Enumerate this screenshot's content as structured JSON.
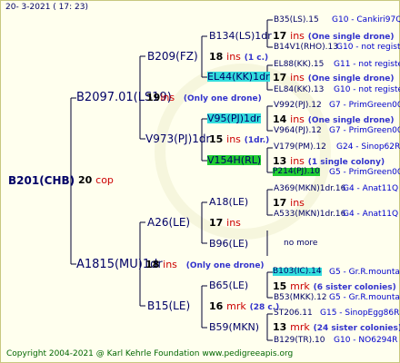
{
  "header": {
    "date": "20-  3-2021  ( 17: 23)"
  },
  "root": {
    "name": "B201(CHB)",
    "count": "20",
    "unit": "cop"
  },
  "gen1": [
    {
      "name": "B2097.01(LS19)",
      "count": "19",
      "unit": "ins",
      "note": "(Only one drone)"
    },
    {
      "name": "A1815(MU)1dr",
      "count": "18",
      "unit": "ins",
      "note": "(Only one drone)"
    }
  ],
  "gen2": [
    {
      "name": "B209(FZ)",
      "count": "18",
      "unit": "ins",
      "note": "(1 c.)"
    },
    {
      "name": "V973(PJ)1dr",
      "count": "15",
      "unit": "ins",
      "note": "(1dr.)"
    },
    {
      "name": "A26(LE)",
      "count": "17",
      "unit": "ins",
      "note": ""
    },
    {
      "name": "B15(LE)",
      "count": "16",
      "unit": "mrk",
      "note": "(28 c.)"
    }
  ],
  "gen3": [
    {
      "name": "B134(LS)1dr",
      "count": "17",
      "unit": "ins",
      "note": "(One single drone)"
    },
    {
      "name": "EL44(KK)1dr",
      "count": "17",
      "unit": "ins",
      "note": "(One single drone)"
    },
    {
      "name": "V95(PJ)1dr",
      "count": "14",
      "unit": "ins",
      "note": "(One single drone)"
    },
    {
      "name": "V154H(RL)",
      "count": "13",
      "unit": "ins",
      "note": "(1 single colony)"
    },
    {
      "name": "A18(LE)",
      "count": "17",
      "unit": "ins",
      "note": ""
    },
    {
      "name": "B96(LE)",
      "count": "",
      "unit": "",
      "note": "no more"
    },
    {
      "name": "B65(LE)",
      "count": "15",
      "unit": "mrk",
      "note": "(6 sister colonies)"
    },
    {
      "name": "B59(MKN)",
      "count": "13",
      "unit": "mrk",
      "note": "(24 sister colonies)"
    }
  ],
  "gen4": [
    {
      "name": "B35(LS).15",
      "group": "G10 - Cankiri97Q"
    },
    {
      "name": "B14V1(RHO).13",
      "group": "G10 - not registe"
    },
    {
      "name": "EL88(KK).15",
      "group": "G11 - not registe"
    },
    {
      "name": "EL84(KK).13",
      "group": "G10 - not registe"
    },
    {
      "name": "V992(PJ).12",
      "group": "G7 - PrimGreen00"
    },
    {
      "name": "V964(PJ).12",
      "group": "G7 - PrimGreen00"
    },
    {
      "name": "V179(PM).12",
      "group": "G24 - Sinop62R"
    },
    {
      "name": "P214(PJ).10",
      "group": "G5 - PrimGreen00"
    },
    {
      "name": "A369(MKN)1dr.16",
      "group": "G4 - Anat11Q"
    },
    {
      "name": "A533(MKN)1dr.16",
      "group": "G4 - Anat11Q"
    },
    {
      "name": "B103(IC).14",
      "group": "G5 - Gr.R.mounta"
    },
    {
      "name": "B53(MKK).12",
      "group": "G5 - Gr.R.mounta"
    },
    {
      "name": "ST206.11",
      "group": "G15 - SinopEgg86R"
    },
    {
      "name": "B129(TR).10",
      "group": "G10 - NO6294R"
    }
  ],
  "footer": {
    "text": "Copyright 2004-2021 @ Karl Kehrle Foundation    www.pedigreeapis.org"
  },
  "colors": {
    "highlight_cyan": "#33dddd",
    "highlight_green": "#22cc33",
    "ins_red": "#cc0000",
    "link_blue": "#0000cc"
  }
}
